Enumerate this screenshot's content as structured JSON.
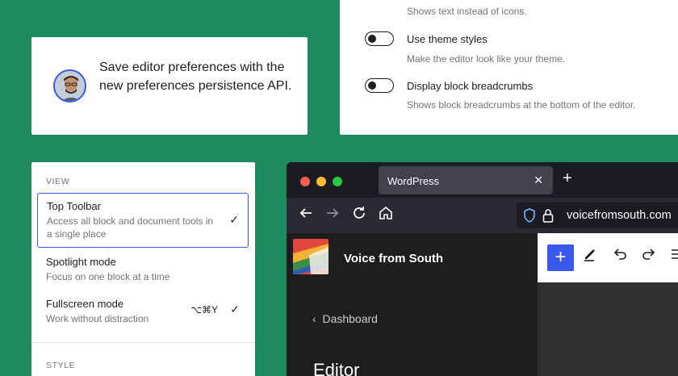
{
  "card_avatar": {
    "text": "Save editor preferences with the new preferences persistence API."
  },
  "preferences": {
    "top_help": "Shows text instead of icons.",
    "items": [
      {
        "label": "Use theme styles",
        "help": "Make the editor look like your theme."
      },
      {
        "label": "Display block breadcrumbs",
        "help": "Shows block breadcrumbs at the bottom of the editor."
      }
    ]
  },
  "menu": {
    "view_title": "VIEW",
    "items": [
      {
        "title": "Top Toolbar",
        "desc": "Access all block and document tools in a single place",
        "check": "✓"
      },
      {
        "title": "Spotlight mode",
        "desc": "Focus on one block at a time"
      },
      {
        "title": "Fullscreen mode",
        "desc": "Work without distraction",
        "shortcut": "⌥⌘Y",
        "check": "✓"
      }
    ],
    "style_title": "STYLE"
  },
  "browser": {
    "tab_title": "WordPress",
    "url": "voicefromsouth.com",
    "site_name": "Voice from South",
    "nav_back": "Dashboard",
    "heading": "Editor",
    "colors": {
      "close": "#ff5f57",
      "minimize": "#febc2e",
      "maximize": "#28c840",
      "accent": "#3858e9"
    },
    "icons": [
      "back-arrow-icon",
      "forward-arrow-icon",
      "reload-icon",
      "home-icon",
      "shield-icon",
      "lock-icon",
      "plus-icon",
      "pencil-icon",
      "undo-icon",
      "redo-icon",
      "list-view-icon"
    ]
  }
}
